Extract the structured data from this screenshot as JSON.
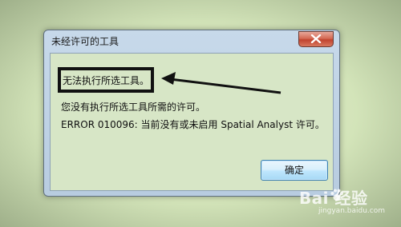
{
  "dialog": {
    "title": "未经许可的工具",
    "message_primary": "无法执行所选工具。",
    "message_detail": "您没有执行所选工具所需的许可。",
    "error_line": "ERROR 010096: 当前没有或未启用 Spatial Analyst 许可。",
    "ok_label": "确定",
    "close_icon": "close-icon"
  },
  "watermark": {
    "brand": "Bai  经验",
    "url": "jingyan.baidu.com"
  },
  "colors": {
    "background": "#d9e8c2",
    "content_bg": "#d7e6c6",
    "frame": "#b8cce0",
    "close_button": "#c0432e",
    "annotation": "#111111"
  }
}
